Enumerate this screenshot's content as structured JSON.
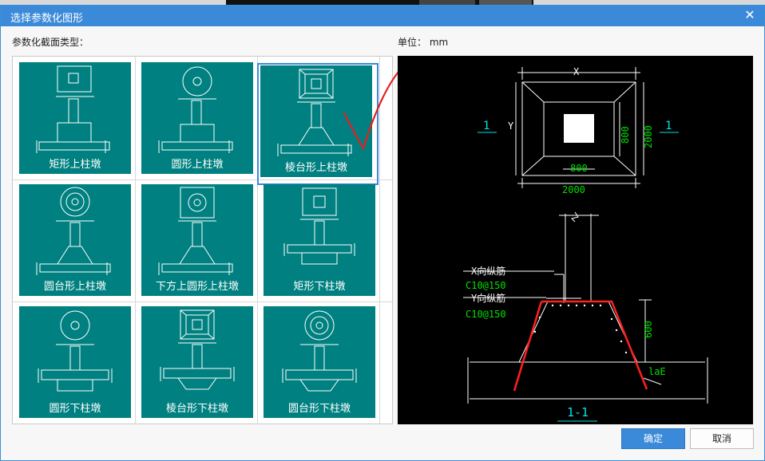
{
  "dialog": {
    "title": "选择参数化图形",
    "close_glyph": "✕"
  },
  "labels": {
    "section_type": "参数化截面类型：",
    "unit": "单位：  mm"
  },
  "shapes": [
    {
      "caption": "矩形上柱墩"
    },
    {
      "caption": "圆形上柱墩"
    },
    {
      "caption": "棱台形上柱墩",
      "selected": true
    },
    {
      "caption": "圆台形上柱墩"
    },
    {
      "caption": "下方上圆形上柱墩"
    },
    {
      "caption": "矩形下柱墩"
    },
    {
      "caption": "圆形下柱墩"
    },
    {
      "caption": "棱台形下柱墩"
    },
    {
      "caption": "圆台形下柱墩"
    }
  ],
  "preview": {
    "dim_x": "X",
    "dim_y": "Y",
    "dim_800_h": "800",
    "dim_2000_h": "2000",
    "dim_800_v": "800",
    "dim_2000_v": "2000",
    "section_mark_left": "1",
    "section_mark_right": "1",
    "rebar_x_label": "X向纵筋",
    "rebar_x_spec": "C10@150",
    "rebar_y_label": "Y向纵筋",
    "rebar_y_spec": "C10@150",
    "dim_600": "600",
    "dim_lae": "laE",
    "section_title": "1-1"
  },
  "buttons": {
    "ok": "确定",
    "cancel": "取消"
  },
  "colors": {
    "accent": "#3b8ad9",
    "tile": "#008080",
    "cad_green": "#00e000",
    "cad_cyan": "#00e5e5",
    "cad_red": "#ff2020"
  }
}
